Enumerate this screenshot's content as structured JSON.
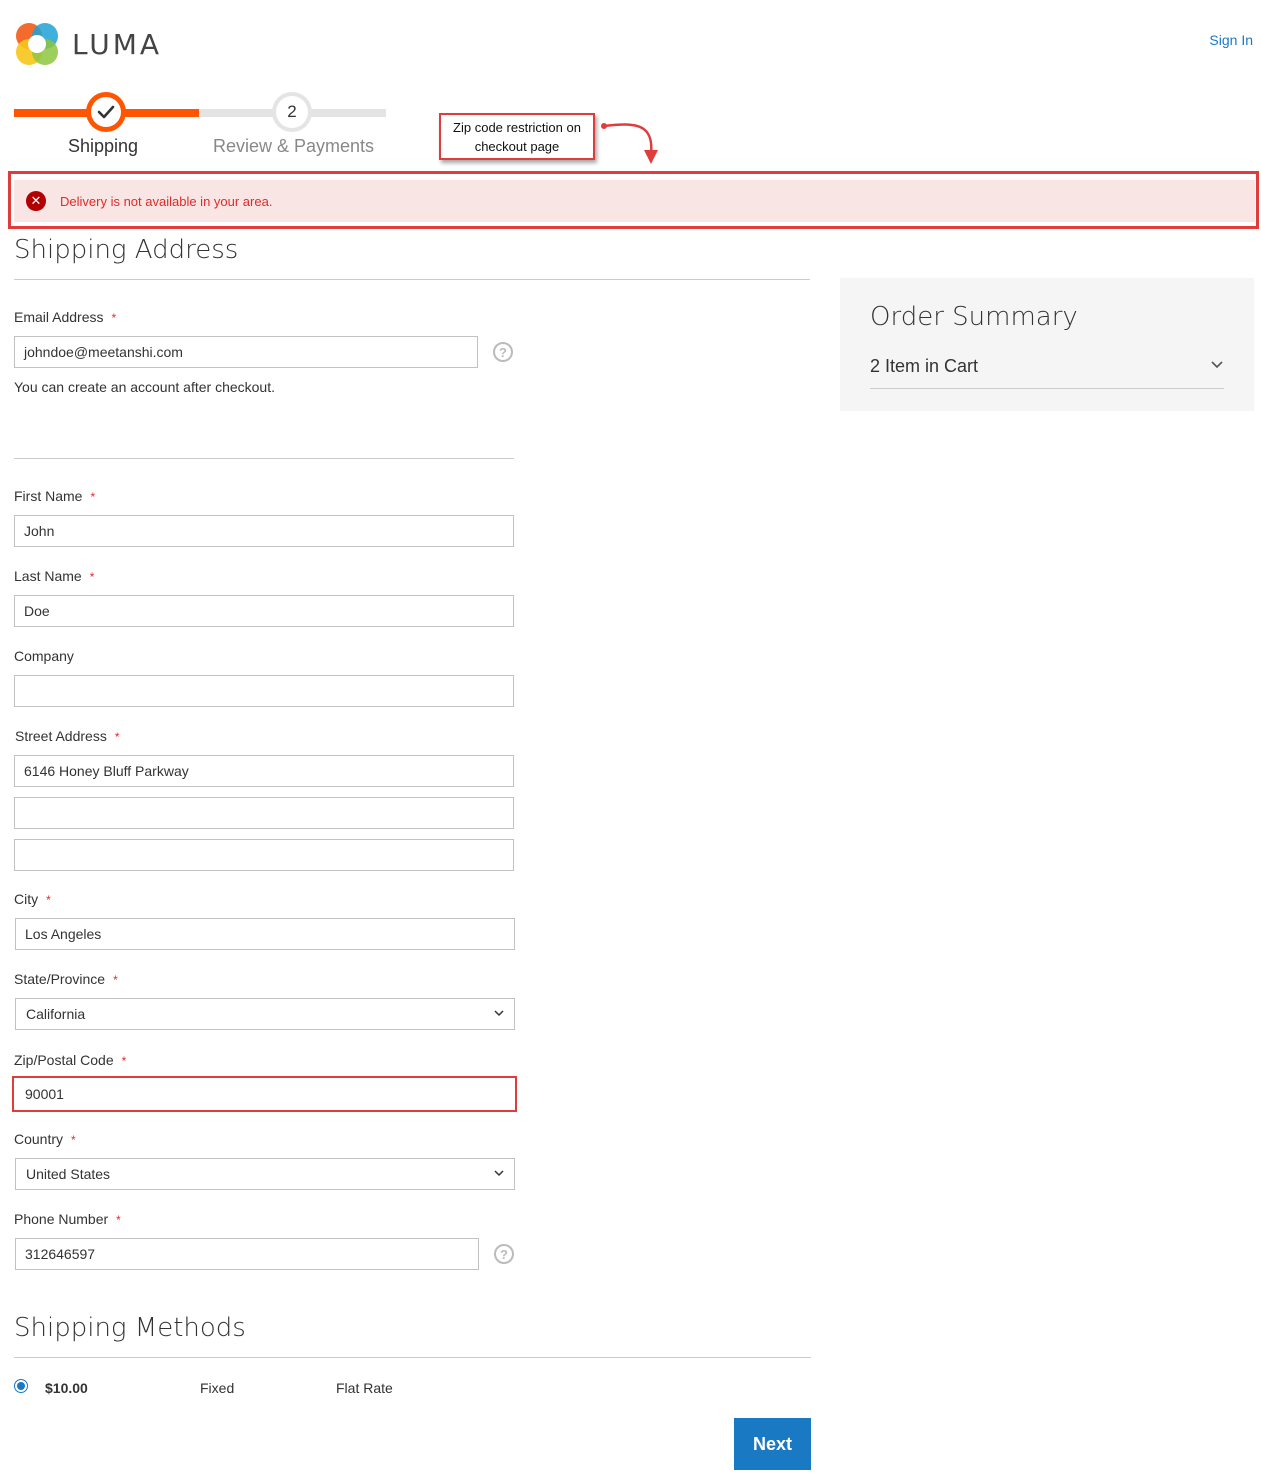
{
  "header": {
    "brand": "LUMA",
    "sign_in": "Sign In"
  },
  "progress": {
    "steps": [
      {
        "label": "Shipping",
        "state": "complete"
      },
      {
        "label": "Review & Payments",
        "number": "2",
        "state": "pending"
      }
    ],
    "fill": 0.5
  },
  "annotation": {
    "line1": "Zip code restriction on",
    "line2": "checkout page"
  },
  "error": {
    "message": "Delivery is not available in your area."
  },
  "shipping_address": {
    "title": "Shipping Address",
    "email": {
      "label": "Email Address",
      "value": "johndoe@meetanshi.com",
      "required": "*"
    },
    "email_note": "You can create an account after checkout.",
    "first_name": {
      "label": "First Name",
      "value": "John",
      "required": "*"
    },
    "last_name": {
      "label": "Last Name",
      "value": "Doe",
      "required": "*"
    },
    "company": {
      "label": "Company",
      "value": ""
    },
    "street": {
      "label": "Street Address",
      "line1": "6146 Honey Bluff Parkway",
      "line2": "",
      "line3": "",
      "required": "*"
    },
    "city": {
      "label": "City",
      "value": "Los Angeles",
      "required": "*"
    },
    "state": {
      "label": "State/Province",
      "value": "California",
      "required": "*"
    },
    "zip": {
      "label": "Zip/Postal Code",
      "value": "90001",
      "required": "*"
    },
    "country": {
      "label": "Country",
      "value": "United States",
      "required": "*"
    },
    "phone": {
      "label": "Phone Number",
      "value": "312646597",
      "required": "*"
    },
    "help_glyph": "?"
  },
  "order_summary": {
    "title": "Order Summary",
    "items": "2 Item in Cart"
  },
  "shipping_methods": {
    "title": "Shipping Methods",
    "methods": [
      {
        "price": "$10.00",
        "method": "Fixed",
        "carrier": "Flat Rate",
        "selected": true
      }
    ]
  },
  "actions": {
    "next": "Next"
  },
  "colors": {
    "accent": "#ff5501",
    "primary_button": "#1979c3",
    "error_bg": "#fae5e5",
    "error_text": "#e02b27",
    "annotation_red": "#e03c3c"
  }
}
